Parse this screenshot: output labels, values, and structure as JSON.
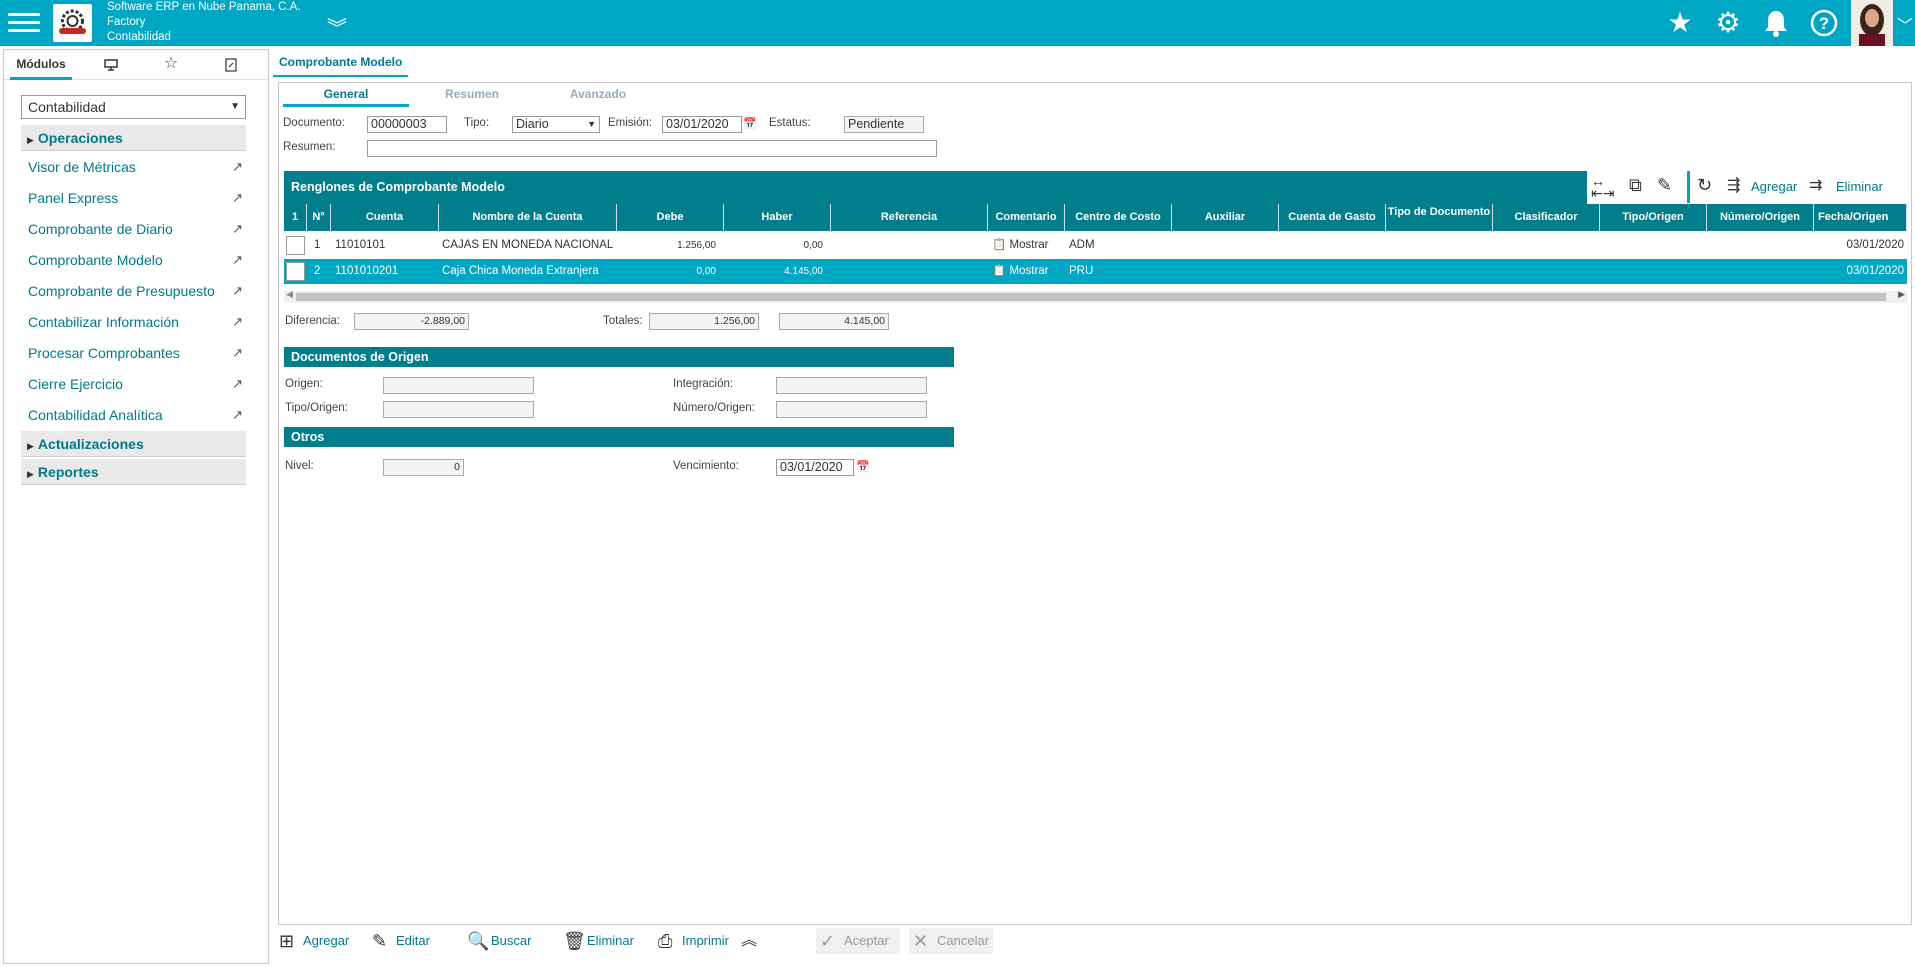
{
  "header": {
    "company": "Software ERP en Nube Panama, C.A.",
    "line2": "Factory",
    "line3": "Contabilidad"
  },
  "left": {
    "tabs": [
      "Módulos"
    ],
    "module_select": "Contabilidad",
    "sections": {
      "operaciones": "Operaciones",
      "actualizaciones": "Actualizaciones",
      "reportes": "Reportes"
    },
    "items": [
      "Visor de Métricas",
      "Panel Express",
      "Comprobante de Diario",
      "Comprobante Modelo",
      "Comprobante de Presupuesto",
      "Contabilizar Información",
      "Procesar Comprobantes",
      "Cierre Ejercicio",
      "Contabilidad Analítica"
    ]
  },
  "main": {
    "tab": "Comprobante Modelo",
    "subtabs": [
      "General",
      "Resumen",
      "Avanzado"
    ],
    "form": {
      "documento_label": "Documento:",
      "documento": "00000003",
      "tipo_label": "Tipo:",
      "tipo": "Diario",
      "emision_label": "Emisión:",
      "emision": "03/01/2020",
      "estatus_label": "Estatus:",
      "estatus": "Pendiente",
      "resumen_label": "Resumen:",
      "resumen": ""
    },
    "grid_title": "Renglones de Comprobante Modelo",
    "grid_tools": {
      "agregar": "Agregar",
      "eliminar": "Eliminar"
    },
    "columns": [
      "1",
      "N°",
      "Cuenta",
      "Nombre de la Cuenta",
      "Debe",
      "Haber",
      "Referencia",
      "Comentario",
      "Centro de Costo",
      "Auxiliar",
      "Cuenta de Gasto",
      "Tipo de Documento",
      "Clasificador",
      "Tipo/Origen",
      "Número/Origen",
      "Fecha/Origen"
    ],
    "rows": [
      {
        "n": "1",
        "cuenta": "11010101",
        "nombre": "CAJAS EN MONEDA NACIONAL",
        "debe": "1.256,00",
        "haber": "0,00",
        "comentario": "Mostrar",
        "centro": "ADM",
        "fecha": "03/01/2020"
      },
      {
        "n": "2",
        "cuenta": "1101010201",
        "nombre": "Caja Chica Moneda Extranjera",
        "debe": "0,00",
        "haber": "4.145,00",
        "comentario": "Mostrar",
        "centro": "PRU",
        "fecha": "03/01/2020"
      }
    ],
    "totals": {
      "diferencia_label": "Diferencia:",
      "diferencia": "-2.889,00",
      "totales_label": "Totales:",
      "debe": "1.256,00",
      "haber": "4.145,00"
    },
    "origen": {
      "title": "Documentos de Origen",
      "origen_label": "Origen:",
      "integracion_label": "Integración:",
      "tipo_label": "Tipo/Origen:",
      "numero_label": "Número/Origen:"
    },
    "otros": {
      "title": "Otros",
      "nivel_label": "Nivel:",
      "nivel": "0",
      "venc_label": "Vencimiento:",
      "venc": "03/01/2020"
    }
  },
  "toolbar": {
    "agregar": "Agregar",
    "editar": "Editar",
    "buscar": "Buscar",
    "eliminar": "Eliminar",
    "imprimir": "Imprimir",
    "aceptar": "Aceptar",
    "cancelar": "Cancelar"
  },
  "colors": {
    "brand": "#00a7c4",
    "dark": "#007e8c"
  }
}
